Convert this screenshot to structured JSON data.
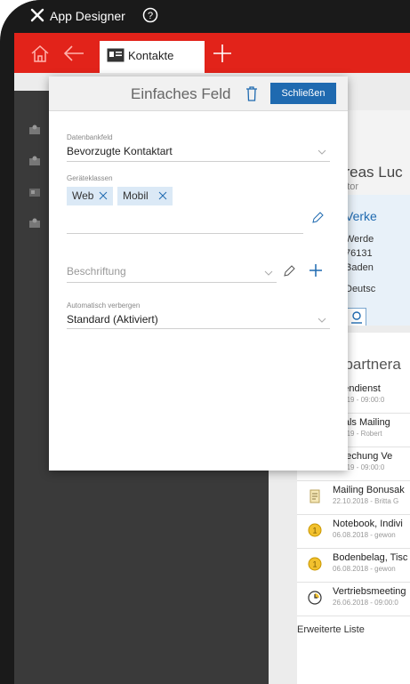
{
  "titlebar": {
    "app_title": "App Designer",
    "tools_icon": "wrench-screwdriver-icon",
    "help_icon": "help-circle-icon"
  },
  "tabbar": {
    "home_icon": "home-icon",
    "back_icon": "back-arrow-icon",
    "active_tab": "Kontakte",
    "add_icon": "plus-icon"
  },
  "colors": {
    "accent_red": "#e2231a",
    "primary_blue": "#1f6ab0",
    "chip_bg": "#dbe9f6",
    "dark_bg": "#1a1a1a"
  },
  "dialog": {
    "title": "Einfaches Feld",
    "close_label": "Schließen",
    "database_field": {
      "label": "Datenbankfeld",
      "value": "Bevorzugte Kontaktart"
    },
    "device_classes": {
      "label": "Geräteklassen",
      "chips": [
        "Web",
        "Mobil"
      ]
    },
    "caption": {
      "placeholder": "Beschriftung"
    },
    "auto_hide": {
      "label": "Automatisch verbergen",
      "value": "Standard (Aktiviert)"
    }
  },
  "person": {
    "name": "dreas Luc",
    "role": "nator",
    "company": "Verke",
    "address_lines": [
      "Werde",
      "76131",
      "Baden",
      "Deutsc"
    ]
  },
  "contacts": {
    "title": "hpartnera",
    "items": [
      {
        "title": "ndendienst",
        "sub": "9.2019 - 09:00:0"
      },
      {
        "title": "artals Mailing",
        "sub": "8.2019 - Robert"
      },
      {
        "title": "sprechung Ve",
        "sub": "4.2019 - 09:00:0"
      },
      {
        "title": "Mailing Bonusak",
        "sub": "22.10.2018 - Britta G",
        "icon": "document-icon"
      },
      {
        "title": "Notebook, Indivi",
        "sub": "06.08.2018 - gewon",
        "icon": "coin-icon"
      },
      {
        "title": "Bodenbelag, Tisc",
        "sub": "06.08.2018 - gewon",
        "icon": "coin-icon"
      },
      {
        "title": "Vertriebsmeeting",
        "sub": "26.06.2018 - 09:00:0",
        "icon": "clock-icon"
      }
    ],
    "more_link": "Erweiterte Liste"
  }
}
